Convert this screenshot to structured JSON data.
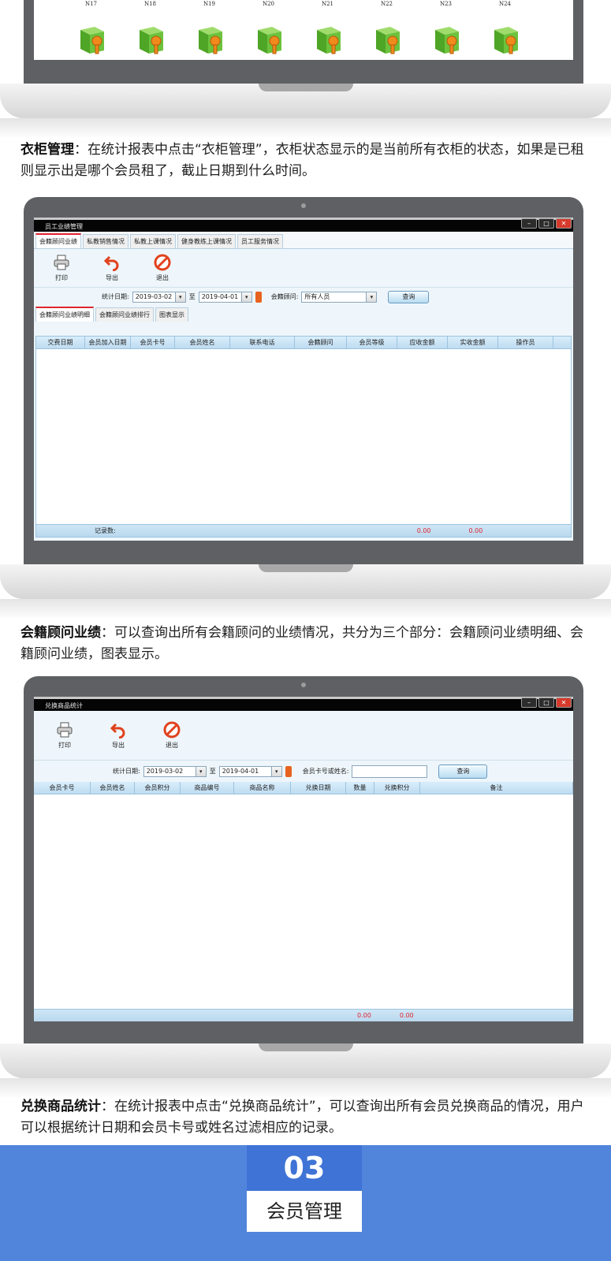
{
  "lockers": {
    "labels": [
      "N17",
      "N18",
      "N19",
      "N20",
      "N21",
      "N22",
      "N23",
      "N24"
    ]
  },
  "sections": {
    "locker_desc": {
      "title": "衣柜管理",
      "text": "：在统计报表中点击“衣柜管理”，衣柜状态显示的是当前所有衣柜的状态，如果是已租则显示出是哪个会员租了，截止日期到什么时间。"
    },
    "advisor_desc": {
      "title": "会籍顾问业绩",
      "text": "：可以查询出所有会籍顾问的业绩情况，共分为三个部分：会籍顾问业绩明细、会籍顾问业绩，图表显示。"
    },
    "exchange_desc": {
      "title": "兑换商品统计",
      "text": "：在统计报表中点击“兑换商品统计”，可以查询出所有会员兑换商品的情况，用户可以根据统计日期和会员卡号或姓名过滤相应的记录。"
    }
  },
  "window1": {
    "title": "员工业绩管理",
    "tabs": [
      "会籍顾问业绩",
      "私教销售情况",
      "私教上课情况",
      "健身教练上课情况",
      "员工服务情况"
    ],
    "toolbar": {
      "print": "打印",
      "export": "导出",
      "exit": "退出"
    },
    "filter": {
      "date_label": "统计日期:",
      "date_from": "2019-03-02",
      "to": "至",
      "date_to": "2019-04-01",
      "advisor_label": "会籍顾问:",
      "advisor_value": "所有人员",
      "query": "查询"
    },
    "subtabs": [
      "会籍顾问业绩明细",
      "会籍顾问业绩排行",
      "图表显示"
    ],
    "columns": [
      "交费日期",
      "会员加入日期",
      "会员卡号",
      "会员姓名",
      "联系电话",
      "会籍顾问",
      "会员等级",
      "应收金额",
      "实收金额",
      "操作员"
    ],
    "footer": {
      "count_label": "记录数:",
      "sum1": "0.00",
      "sum2": "0.00"
    }
  },
  "window2": {
    "title": "兑换商品统计",
    "toolbar": {
      "print": "打印",
      "export": "导出",
      "exit": "退出"
    },
    "filter": {
      "date_label": "统计日期:",
      "date_from": "2019-03-02",
      "to": "至",
      "date_to": "2019-04-01",
      "member_label": "会员卡号或姓名:",
      "member_value": "",
      "query": "查询"
    },
    "columns": [
      "会员卡号",
      "会员姓名",
      "会员积分",
      "商品编号",
      "商品名称",
      "兑换日期",
      "数量",
      "兑换积分",
      "备注"
    ],
    "footer": {
      "sum1": "0.00",
      "sum2": "0.00"
    }
  },
  "banner": {
    "number": "03",
    "title": "会员管理"
  },
  "colors": {
    "accent": "#5185dc",
    "banner_dark": "#3f73d6",
    "tab_active": "#e0232f",
    "grid_head": "#bfdcf1"
  }
}
